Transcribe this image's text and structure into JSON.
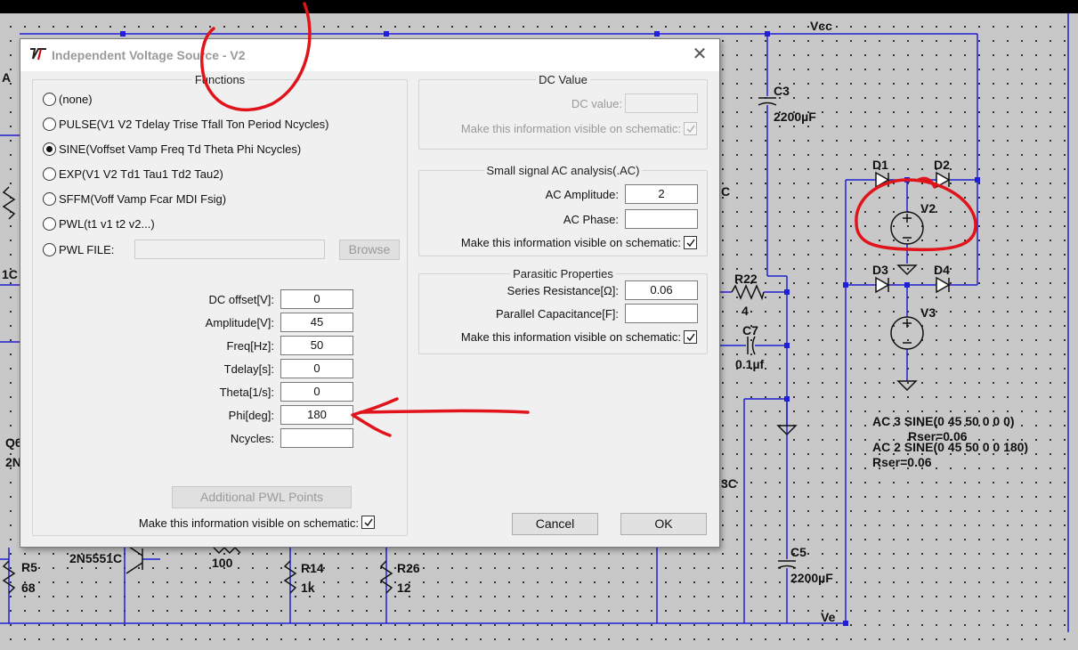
{
  "dialog": {
    "title": "Independent Voltage Source - V2",
    "close_glyph": "✕",
    "functions": {
      "legend": "Functions",
      "options": [
        {
          "label": "(none)",
          "checked": false
        },
        {
          "label": "PULSE(V1 V2 Tdelay Trise Tfall Ton Period Ncycles)",
          "checked": false
        },
        {
          "label": "SINE(Voffset Vamp Freq Td Theta Phi Ncycles)",
          "checked": true
        },
        {
          "label": "EXP(V1 V2 Td1 Tau1 Td2 Tau2)",
          "checked": false
        },
        {
          "label": "SFFM(Voff Vamp Fcar MDI Fsig)",
          "checked": false
        },
        {
          "label": "PWL(t1 v1 t2 v2...)",
          "checked": false
        },
        {
          "label": "PWL FILE:",
          "checked": false
        }
      ],
      "pwl_file_value": "",
      "browse_label": "Browse",
      "params": [
        {
          "label": "DC offset[V]:",
          "value": "0"
        },
        {
          "label": "Amplitude[V]:",
          "value": "45"
        },
        {
          "label": "Freq[Hz]:",
          "value": "50"
        },
        {
          "label": "Tdelay[s]:",
          "value": "0"
        },
        {
          "label": "Theta[1/s]:",
          "value": "0"
        },
        {
          "label": "Phi[deg]:",
          "value": "180"
        },
        {
          "label": "Ncycles:",
          "value": ""
        }
      ],
      "additional_pwl_label": "Additional PWL Points",
      "visible_label": "Make this information visible on schematic:",
      "visible_checked": true
    },
    "dc_value": {
      "legend": "DC Value",
      "label": "DC value:",
      "value": "",
      "visible_label": "Make this information visible on schematic:",
      "visible_checked": true
    },
    "ac": {
      "legend": "Small signal AC analysis(.AC)",
      "amplitude_label": "AC Amplitude:",
      "amplitude_value": "2",
      "phase_label": "AC Phase:",
      "phase_value": "",
      "visible_label": "Make this information visible on schematic:",
      "visible_checked": true
    },
    "parasitic": {
      "legend": "Parasitic Properties",
      "series_label": "Series Resistance[Ω]:",
      "series_value": "0.06",
      "parallel_label": "Parallel Capacitance[F]:",
      "parallel_value": "",
      "visible_label": "Make this information visible on schematic:",
      "visible_checked": true
    },
    "cancel_label": "Cancel",
    "ok_label": "OK"
  },
  "schematic": {
    "labels": {
      "vcc": "Vcc",
      "ve": "Ve",
      "c3": "C3",
      "c3_val": "2200µF",
      "c5": "C5",
      "c5_val": "2200µF",
      "c7": "C7",
      "c7_val": "0.1µf",
      "r22": "R22",
      "r22_val": "4",
      "d1": "D1",
      "d2": "D2",
      "d3": "D3",
      "d4": "D4",
      "v2": "V2",
      "v3": "V3",
      "ac3": "AC 3  SINE(0 45 50 0 0 0)",
      "rser3": "Rser=0.06",
      "ac2": "AC 2  SINE(0 45 50 0 0 180)",
      "rser2": "Rser=0.06",
      "r5": "R5",
      "r5_val": "68",
      "q_model": "2N5551C",
      "r_100": "100",
      "r14": "R14",
      "r14_val": "1k",
      "r26": "R26",
      "r26_val": "12",
      "frag_1c": "1C",
      "frag_q6": "Q6",
      "frag_2n": "2N",
      "frag_3c": "3C",
      "frag_c": "C",
      "frag_a": "A"
    }
  }
}
